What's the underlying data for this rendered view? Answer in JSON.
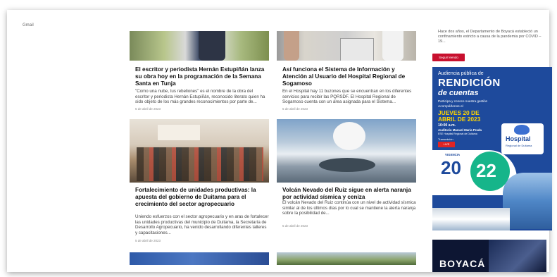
{
  "header": {
    "label": "Gmail"
  },
  "articles": [
    {
      "title": "El escritor y periodista Hernán Estupiñán lanza su obra hoy en la programación de la Semana Santa en Tunja",
      "excerpt": "\"Como una nube, tus rebeliones\" es el nombre de la obra del escritor y periodista Hernán Estupiñán, reconocido literato quien ha sido objeto de los más grandes reconocimientos por parte de...",
      "date": "5 de abril de 2023"
    },
    {
      "title": "Así funciona el Sistema de Información y Atención al Usuario del Hospital Regional de Sogamoso",
      "excerpt": "En el Hospital hay 11 buzones que se encuentran en los diferentes servicios para recibir las PQRSDF. El Hospital Regional de Sogamoso cuenta con un área asignada para el Sistema...",
      "date": "5 de abril de 2023"
    },
    {
      "title": "Fortalecimiento de unidades productivas: la apuesta del gobierno de Duitama para el crecimiento del sector agropecuario",
      "excerpt": "Uniendo esfuerzos con el sector agropecuario y en aras de fortalecer las unidades productivas del municipio de Duitama, la Secretaría de Desarrollo Agropecuario, ha venido desarrollando diferentes talleres y capacitaciones...",
      "date": "5 de abril de 2023"
    },
    {
      "title": "Volcán Nevado del Ruiz sigue en alerta naranja por actividad sísmica y ceniza",
      "excerpt": "El volcán Nevado del Ruiz continúa con un nivel de actividad sísmica similar al de los últimos días por lo cual se mantiene la alerta naranja sobre la posibilidad de...",
      "date": "5 de abril de 2023"
    }
  ],
  "sidebar": {
    "snippet": "Hace dos años, el Departamento de Boyacá estableció un confinamiento estricto a causa de la pandemia por COVID – 19...",
    "read_more": "Seguir leendo",
    "banner": {
      "line1": "Audiencia pública de",
      "line2": "RENDICIÓN",
      "line3": "de cuentas",
      "line4": "Participa y conoce nuestra gestión",
      "line5": "Acompáñenos el",
      "line6": "JUEVES 20 DE",
      "line7": "ABRIL DE 2023",
      "line8": "10:00 a.m.",
      "line9": "Auditorio Manuel María Prada",
      "line10": "ESE Hospital Regional de Duitama",
      "line11": "Transmisión",
      "live": "LIVE",
      "vigencia": "VIGENCIA",
      "year_a": "20",
      "year_b": "22",
      "logo_big": "Hospital",
      "logo_small": "Regional de Duitama"
    },
    "bottom_ad": "BOYACÁ"
  }
}
